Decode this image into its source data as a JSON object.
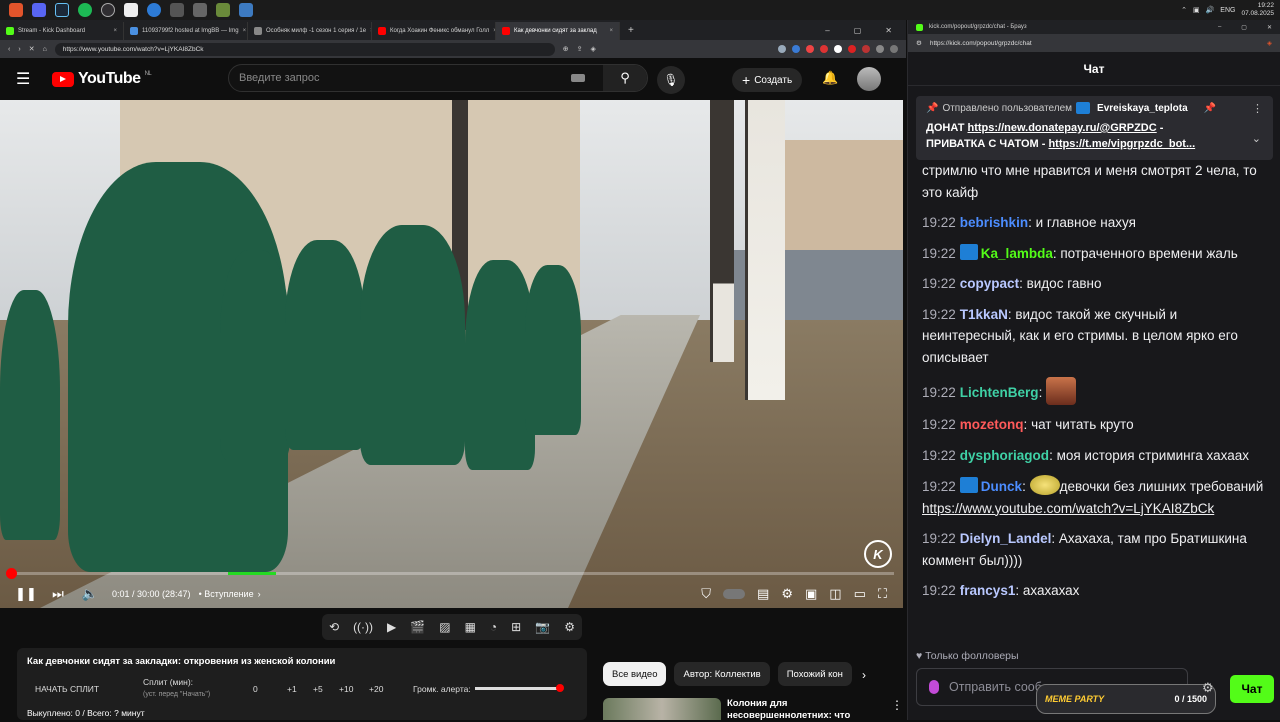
{
  "taskbar": {
    "icons": [
      "brave-icon",
      "discord-icon",
      "steam-icon",
      "spotify-icon",
      "obs-icon",
      "capcut-icon",
      "app-icon-7",
      "app-icon-8",
      "app-icon-9",
      "app-icon-10",
      "app-icon-11",
      "app-icon-12"
    ],
    "lang": "ENG",
    "time": "19:22",
    "date": "07.08.2025"
  },
  "browser": {
    "tabs": [
      {
        "label": "Stream - Kick Dashboard",
        "color": "#53fc18"
      },
      {
        "label": "11093799f2 hosted at ImgBB — Img",
        "color": "#4a90e2"
      },
      {
        "label": "Особняк милф -1 сезон 1 серия / 1e",
        "color": "#888888"
      },
      {
        "label": "Когда Хоакин Феникс обманул Голл",
        "color": "#ff0000"
      },
      {
        "label": "Как девчонки сидят за заклад",
        "color": "#ff0000"
      }
    ],
    "url": "https://www.youtube.com/watch?v=LjYKAI8ZbCk"
  },
  "youtube": {
    "logo_text": "YouTube",
    "region": "NL",
    "search_placeholder": "Введите запрос",
    "create_label": "Создать",
    "player": {
      "time": "0:01 / 30:00 (28:47)",
      "chapter": "• Вступление",
      "progress_fraction": 0.001,
      "watermark": "K"
    },
    "video_title": "Как девчонки сидят за закладки: откровения из женской колонии",
    "split": {
      "start_label": "НАЧАТЬ СПЛИТ",
      "split_label": "Сплит (мин):",
      "split_hint": "(уст. перед \"Начать\")",
      "value": "0",
      "steps": [
        "+1",
        "+5",
        "+10",
        "+20"
      ],
      "volume_label": "Громк. алерта:",
      "bought": "Выкуплено: 0 / Всего: ? минут"
    },
    "chips": [
      "Все видео",
      "Автор: Коллектив",
      "Похожий кон"
    ],
    "rec_title": "Колония для несовершеннолетних: что"
  },
  "chat": {
    "url": "https://kick.com/popout/grpzdc/chat",
    "tab_label": "kick.com/popout/grpzdc/chat - Брауз",
    "header": "Чат",
    "pinned": {
      "sent_by": "Отправлено пользователем",
      "user": "Evreiskaya_teplota",
      "line1_prefix": "ДОНАТ",
      "line1_link": "https://new.donatepay.ru/@GRPZDC",
      "line1_suffix": "-",
      "line2_prefix": "ПРИВАТКА С ЧАТОМ -",
      "line2_link": "https://t.me/vipgrpzdc_bot..."
    },
    "messages": [
      {
        "time": "",
        "user": "",
        "color": "#efeff1",
        "text": "стримлю что мне нравится и меня смотрят 2 чела, то это кайф"
      },
      {
        "time": "19:22",
        "user": "bebrishkin",
        "color": "#4c8dff",
        "text": "и главное нахуя"
      },
      {
        "time": "19:22",
        "user": "Ka_lambda",
        "color": "#53fc18",
        "text": "потраченного времени жаль"
      },
      {
        "time": "19:22",
        "user": "copypact",
        "color": "#b9c8ff",
        "text": "видос гавно"
      },
      {
        "time": "19:22",
        "user": "T1kkaN",
        "color": "#b9c8ff",
        "text": "видос такой же скучный и неинтересный, как и его стримы. в целом ярко его описывает"
      },
      {
        "time": "19:22",
        "user": "LichtenBerg",
        "color": "#3fd1a6",
        "text": ""
      },
      {
        "time": "19:22",
        "user": "mozetonq",
        "color": "#ff5a5a",
        "text": "чат читать круто"
      },
      {
        "time": "19:22",
        "user": "dysphoriagod",
        "color": "#3fd1a6",
        "text": "моя история стриминга хахаах"
      },
      {
        "time": "19:22",
        "user": "Dunck",
        "color": "#4c8dff",
        "text": "девочки без лишних требований",
        "link": "https://www.youtube.com/watch?v=LjYKAI8ZbCk"
      },
      {
        "time": "19:22",
        "user": "Dielyn_Landel",
        "color": "#b9c8ff",
        "text": "Ахахаха, там про Братишкина коммент был))))"
      },
      {
        "time": "19:22",
        "user": "francys1",
        "color": "#b9c8ff",
        "text": "ахахахах"
      }
    ],
    "followers_only": "Только фолловеры",
    "input_placeholder": "Отправить сооб",
    "meme_party": "MEME PARTY",
    "meme_count": "0 / 1500",
    "send_label": "Чат"
  }
}
